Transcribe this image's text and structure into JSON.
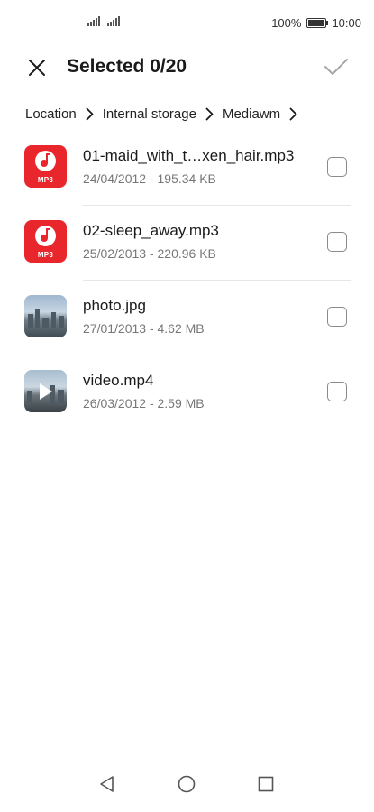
{
  "status_bar": {
    "battery_percent": "100%",
    "time": "10:00"
  },
  "header": {
    "title": "Selected 0/20"
  },
  "breadcrumb": {
    "items": [
      "Location",
      "Internal storage",
      "Mediawm"
    ]
  },
  "files": [
    {
      "name": "01-maid_with_t…xen_hair.mp3",
      "meta": "24/04/2012 - 195.34 KB",
      "type": "mp3",
      "type_label": "MP3",
      "checked": false
    },
    {
      "name": "02-sleep_away.mp3",
      "meta": "25/02/2013 - 220.96 KB",
      "type": "mp3",
      "type_label": "MP3",
      "checked": false
    },
    {
      "name": "photo.jpg",
      "meta": "27/01/2013 - 4.62 MB",
      "type": "image",
      "checked": false
    },
    {
      "name": "video.mp4",
      "meta": "26/03/2012 - 2.59 MB",
      "type": "video",
      "checked": false
    }
  ],
  "colors": {
    "mp3_icon": "#e8262b",
    "checkbox_border": "#8a8a8a"
  },
  "icons": {
    "close": "close-icon",
    "confirm": "check-icon",
    "breadcrumb_separator": "chevron-right-icon",
    "nav_back": "back-triangle-icon",
    "nav_home": "home-circle-icon",
    "nav_recents": "recents-square-icon"
  }
}
